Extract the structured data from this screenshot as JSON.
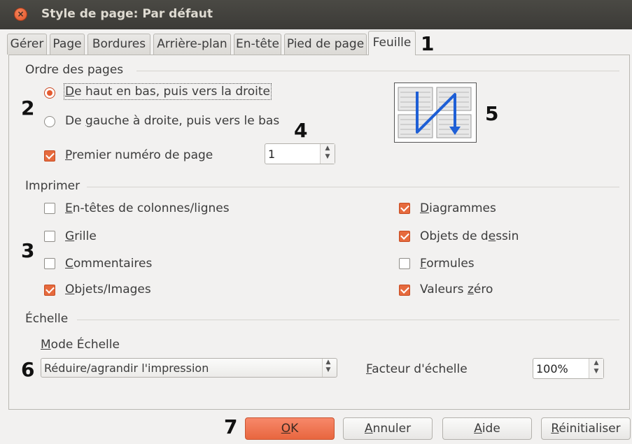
{
  "window": {
    "title": "Style de page: Par défaut",
    "close_glyph": "×"
  },
  "tabs": [
    "Gérer",
    "Page",
    "Bordures",
    "Arrière-plan",
    "En-tête",
    "Pied de page",
    "Feuille"
  ],
  "active_tab": "Feuille",
  "callouts": {
    "c1": "1",
    "c2": "2",
    "c3": "3",
    "c4": "4",
    "c5": "5",
    "c6": "6",
    "c7": "7"
  },
  "page_order": {
    "label": "Ordre des pages",
    "option1": {
      "u": "D",
      "rest": "e haut en bas, puis vers la droite",
      "checked": true
    },
    "option2": {
      "pre": "De ",
      "u": "g",
      "rest": "auche à droite, puis vers le bas",
      "checked": false
    },
    "first_page": {
      "u": "P",
      "rest": "remier numéro de page",
      "checked": true,
      "value": "1"
    }
  },
  "print": {
    "label": "Imprimer",
    "headers": {
      "u": "E",
      "rest": "n-têtes de colonnes/lignes",
      "checked": false
    },
    "grid": {
      "u": "G",
      "rest": "rille",
      "checked": false
    },
    "comments": {
      "u": "C",
      "rest": "ommentaires",
      "checked": false
    },
    "objects": {
      "u": "O",
      "rest": "bjets/Images",
      "checked": true
    },
    "charts": {
      "u": "D",
      "rest": "iagrammes",
      "checked": true
    },
    "drawings": {
      "pre": "Objets de d",
      "u": "e",
      "rest": "ssin",
      "checked": true
    },
    "formulas": {
      "u": "F",
      "rest": "ormules",
      "checked": false
    },
    "zeros": {
      "pre": "Valeurs ",
      "u": "z",
      "rest": "éro",
      "checked": true
    }
  },
  "scale": {
    "label": "Échelle",
    "mode_label": {
      "u": "M",
      "rest": "ode Échelle"
    },
    "mode_value": "Réduire/agrandir l'impression",
    "factor_label": {
      "u": "F",
      "rest": "acteur d'échelle"
    },
    "factor_value": "100%"
  },
  "buttons": {
    "ok": {
      "u": "O",
      "rest": "K"
    },
    "cancel": {
      "u": "A",
      "rest": "nnuler"
    },
    "help": {
      "u": "A",
      "rest": "ide"
    },
    "reset": {
      "u": "R",
      "rest": "éinitialiser"
    }
  },
  "colors": {
    "accent": "#e66a3d",
    "titlebar": "#3c3b37",
    "background": "#f2f1f0"
  }
}
